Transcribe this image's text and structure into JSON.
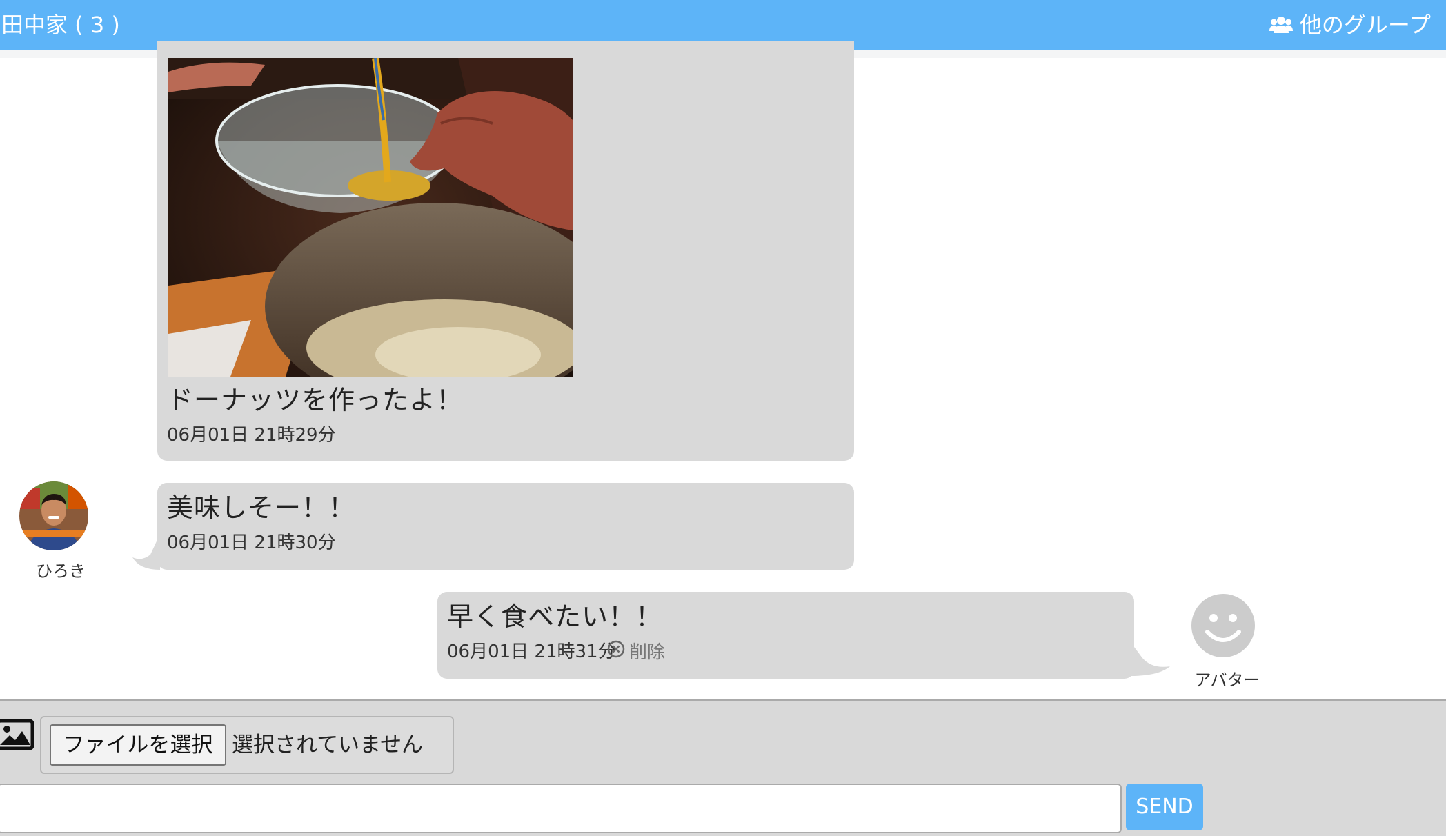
{
  "header": {
    "title": "田中家 ( 3 )",
    "groups_icon": "users-icon",
    "groups_label": "他のグループ",
    "color": "#5db4f8"
  },
  "messages": [
    {
      "type": "image",
      "image_description_icon": "photo-image",
      "text": "ドーナッツを作ったよ！",
      "time": "06月01日 21時29分"
    },
    {
      "type": "text",
      "sender": "ひろき",
      "text": "美味しそー！！",
      "time": "06月01日 21時30分"
    },
    {
      "type": "text",
      "sender": "アバター",
      "avatar_icon": "smiley-face-icon",
      "text": "早く食べたい！！",
      "time": "06月01日 21時31分",
      "delete_icon": "circle-x-icon",
      "delete_label": "削除"
    }
  ],
  "footer": {
    "image_icon": "image-icon",
    "file_button_label": "ファイルを選択",
    "file_status": "選択されていません",
    "message_placeholder": "",
    "send_label": "SEND",
    "bubble_color": "#d9d9d9"
  }
}
